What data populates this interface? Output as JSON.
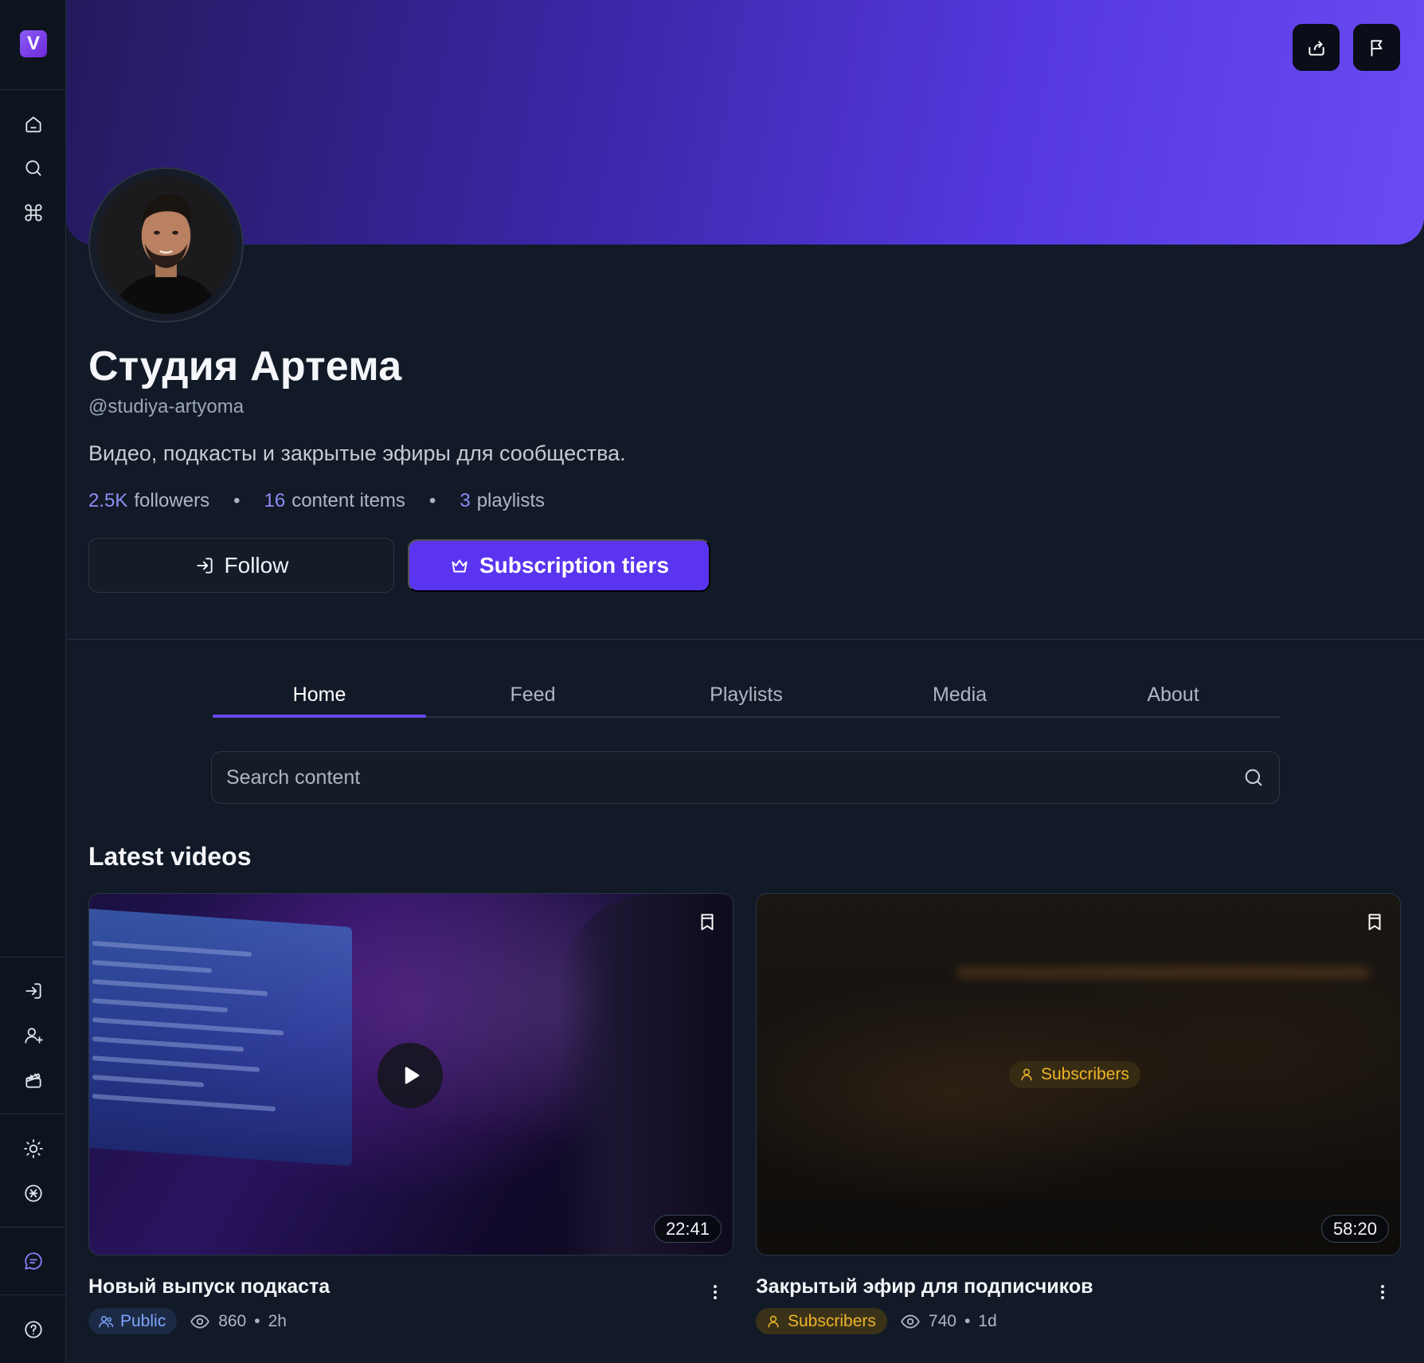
{
  "sidebar": {
    "logo_letter": "V",
    "top_icons": [
      "home-icon",
      "search-icon",
      "command-icon"
    ],
    "mid_icons": [
      "login-icon",
      "user-plus-icon",
      "clapperboard-icon"
    ],
    "bottom_icons": [
      "sun-icon",
      "currency-icon"
    ],
    "chat_icon": "chat-icon",
    "help_icon": "help-icon"
  },
  "banner": {
    "gradient_start": "#241a5c",
    "gradient_end": "#6b4bf2",
    "actions": [
      "share-icon",
      "flag-icon"
    ]
  },
  "profile": {
    "name": "Студия Артема",
    "handle": "@studiya-artyoma",
    "bio": "Видео, подкасты и закрытые эфиры для сообщества.",
    "stats": {
      "followers_value": "2.5K",
      "followers_label": "followers",
      "content_value": "16",
      "content_label": "content items",
      "playlists_value": "3",
      "playlists_label": "playlists",
      "separator": "•"
    },
    "follow_label": "Follow",
    "subscription_label": "Subscription tiers"
  },
  "tabs": [
    {
      "label": "Home",
      "active": true
    },
    {
      "label": "Feed",
      "active": false
    },
    {
      "label": "Playlists",
      "active": false
    },
    {
      "label": "Media",
      "active": false
    },
    {
      "label": "About",
      "active": false
    }
  ],
  "search": {
    "placeholder": "Search content",
    "value": ""
  },
  "latest": {
    "title": "Latest videos",
    "videos": [
      {
        "title": "Новый выпуск подкаста",
        "duration": "22:41",
        "visibility": "Public",
        "views": "860",
        "age": "2h",
        "sep": "•"
      },
      {
        "title": "Закрытый эфир для подписчиков",
        "duration": "58:20",
        "visibility": "Subscribers",
        "lock_badge": "Subscribers",
        "views": "740",
        "age": "1d",
        "sep": "•"
      }
    ]
  },
  "colors": {
    "accent": "#5b34f0",
    "link": "#8f8cf5",
    "public": "#7ea6ff",
    "subscribers": "#f0b429",
    "background": "#111a26"
  }
}
